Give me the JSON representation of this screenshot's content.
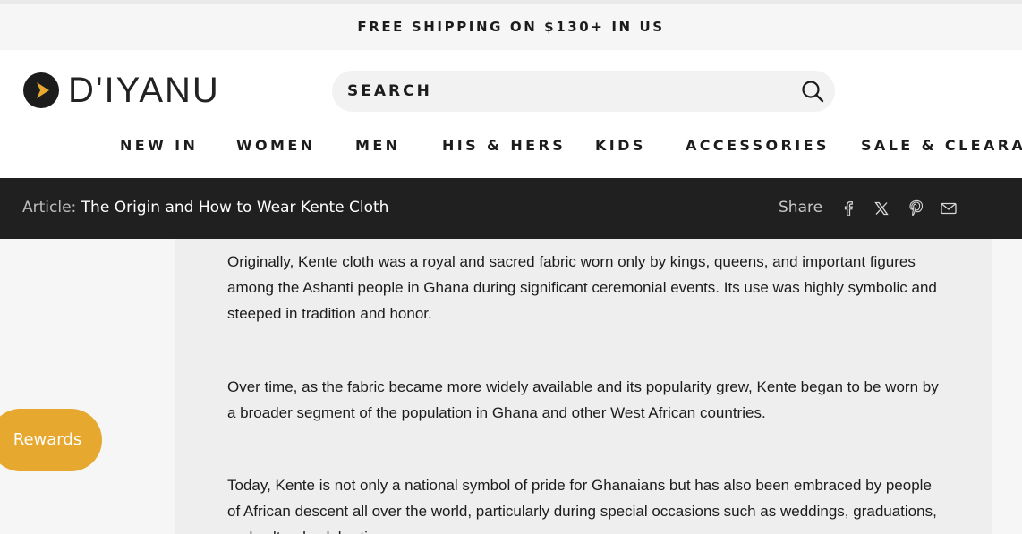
{
  "announcement": "FREE SHIPPING ON $130+ IN US",
  "brand": {
    "name": "D'IYANU",
    "accent_color": "#e6a82f",
    "logo_icon": "play-triangle-icon"
  },
  "search": {
    "placeholder": "SEARCH",
    "value": "",
    "icon": "search-icon"
  },
  "nav": {
    "items": [
      {
        "label": "NEW IN"
      },
      {
        "label": "WOMEN"
      },
      {
        "label": "MEN"
      },
      {
        "label": "HIS & HERS"
      },
      {
        "label": "KIDS"
      },
      {
        "label": "ACCESSORIES"
      },
      {
        "label": "SALE & CLEARAN"
      }
    ]
  },
  "article_bar": {
    "prefix": "Article:",
    "title": "The Origin and How to Wear Kente Cloth",
    "share_label": "Share",
    "share_icons": [
      "facebook-icon",
      "x-icon",
      "pinterest-icon",
      "email-icon"
    ],
    "background_color": "#202020"
  },
  "content": {
    "paragraphs": [
      "Originally, Kente cloth was a royal and sacred fabric worn only by kings, queens, and important figures among the Ashanti people in Ghana during significant ceremonial events. Its use was highly symbolic and steeped in tradition and honor.",
      "Over time, as the fabric became more widely available and its popularity grew, Kente began to be worn by a broader segment of the population in Ghana and other West African countries.",
      "Today, Kente is not only a national symbol of pride for Ghanaians but has also been embraced by people of African descent all over the world, particularly during special occasions such as weddings, graduations, and cultural celebrations."
    ]
  },
  "rewards": {
    "label": "Rewards",
    "color": "#e6a82f"
  }
}
